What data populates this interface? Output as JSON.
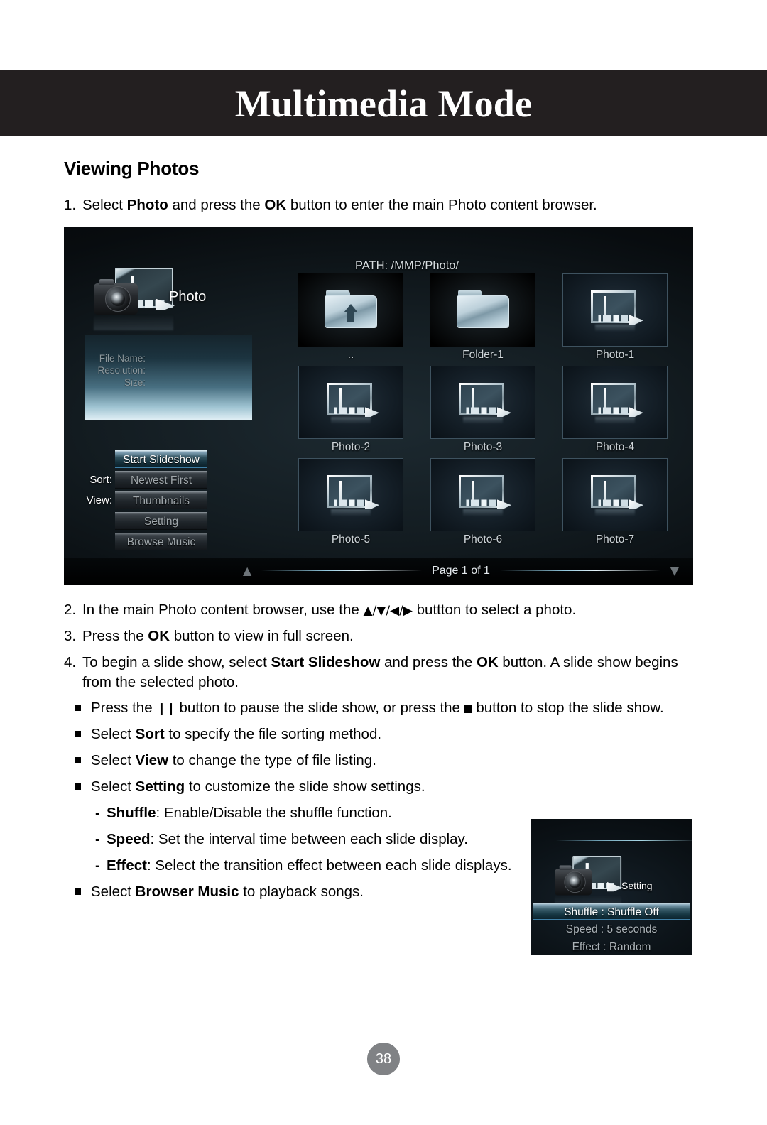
{
  "chapter": {
    "title": "Multimedia Mode"
  },
  "section": {
    "heading": "Viewing Photos"
  },
  "steps": [
    {
      "num": "1.",
      "parts": [
        {
          "t": "Select ",
          "b": false
        },
        {
          "t": "Photo",
          "b": true
        },
        {
          "t": " and press the ",
          "b": false
        },
        {
          "t": "OK",
          "b": true
        },
        {
          "t": " button to enter the main Photo content browser.",
          "b": false
        }
      ]
    },
    {
      "num": "2.",
      "parts": [
        {
          "t": "In the main Photo content browser, use the ",
          "b": false
        },
        {
          "t": "▲/▼/◀/▶",
          "b": false,
          "glyph": true
        },
        {
          "t": " buttton to select a photo.",
          "b": false
        }
      ]
    },
    {
      "num": "3.",
      "parts": [
        {
          "t": "Press the ",
          "b": false
        },
        {
          "t": "OK",
          "b": true
        },
        {
          "t": " button to view in full screen.",
          "b": false
        }
      ]
    },
    {
      "num": "4.",
      "parts": [
        {
          "t": "To begin a slide show, select ",
          "b": false
        },
        {
          "t": "Start Slideshow",
          "b": true
        },
        {
          "t": " and press the ",
          "b": false
        },
        {
          "t": "OK",
          "b": true
        },
        {
          "t": " button. A slide show begins from the selected photo.",
          "b": false
        }
      ]
    }
  ],
  "bullets": [
    {
      "parts": [
        {
          "t": "Press the ",
          "b": false
        },
        {
          "t": "❙❙",
          "b": false,
          "pause": true
        },
        {
          "t": " button to pause the slide show, or press the ",
          "b": false
        },
        {
          "t": "",
          "b": false,
          "stop": true
        },
        {
          "t": " button to stop the slide show.",
          "b": false
        }
      ]
    },
    {
      "parts": [
        {
          "t": "Select ",
          "b": false
        },
        {
          "t": "Sort",
          "b": true
        },
        {
          "t": " to specify the file sorting method.",
          "b": false
        }
      ]
    },
    {
      "parts": [
        {
          "t": "Select ",
          "b": false
        },
        {
          "t": "View",
          "b": true
        },
        {
          "t": " to change the type of file listing.",
          "b": false
        }
      ]
    },
    {
      "parts": [
        {
          "t": "Select ",
          "b": false
        },
        {
          "t": "Setting",
          "b": true
        },
        {
          "t": " to customize the slide show settings.",
          "b": false
        }
      ]
    }
  ],
  "subitems": [
    {
      "dash": "-",
      "parts": [
        {
          "t": "Shuffle",
          "b": true
        },
        {
          "t": ": Enable/Disable the shuffle function.",
          "b": false
        }
      ]
    },
    {
      "dash": "-",
      "parts": [
        {
          "t": "Speed",
          "b": true
        },
        {
          "t": ": Set the interval time between each slide display.",
          "b": false
        }
      ]
    },
    {
      "dash": "-",
      "parts": [
        {
          "t": "Effect",
          "b": true
        },
        {
          "t": ": Select the transition effect between each slide displays.",
          "b": false
        }
      ]
    }
  ],
  "last_bullet": {
    "parts": [
      {
        "t": "Select ",
        "b": false
      },
      {
        "t": "Browser Music",
        "b": true
      },
      {
        "t": " to playback songs.",
        "b": false
      }
    ]
  },
  "photo_browser": {
    "path": "PATH: /MMP/Photo/",
    "mode_label": "Photo",
    "info": {
      "file_name": "File Name:",
      "resolution": "Resolution:",
      "size": "Size:"
    },
    "sort_caption": "Sort:",
    "view_caption": "View:",
    "buttons": [
      {
        "label": "Start Slideshow",
        "selected": true
      },
      {
        "label": "Newest First",
        "selected": false
      },
      {
        "label": "Thumbnails",
        "selected": false
      },
      {
        "label": "Setting",
        "selected": false
      },
      {
        "label": "Browse Music",
        "selected": false
      }
    ],
    "thumbnails": [
      {
        "label": "..",
        "kind": "folder-up"
      },
      {
        "label": "Folder-1",
        "kind": "folder"
      },
      {
        "label": "Photo-1",
        "kind": "picture"
      },
      {
        "label": "Photo-2",
        "kind": "picture"
      },
      {
        "label": "Photo-3",
        "kind": "picture"
      },
      {
        "label": "Photo-4",
        "kind": "picture"
      },
      {
        "label": "Photo-5",
        "kind": "picture"
      },
      {
        "label": "Photo-6",
        "kind": "picture"
      },
      {
        "label": "Photo-7",
        "kind": "picture"
      }
    ],
    "page_indicator": "Page 1 of 1",
    "scroll_up": "▲",
    "scroll_down": "▼"
  },
  "setting_panel": {
    "mode_label": "Setting",
    "rows": [
      {
        "label": "Shuffle : Shuffle Off",
        "selected": true
      },
      {
        "label": "Speed : 5 seconds",
        "selected": false
      },
      {
        "label": "Effect : Random",
        "selected": false
      }
    ]
  },
  "footer": {
    "page_number": "38"
  },
  "colors": {
    "title_bar": "#231f20",
    "page_number_badge": "#808285",
    "selection_accent": "#3f7fa6"
  }
}
